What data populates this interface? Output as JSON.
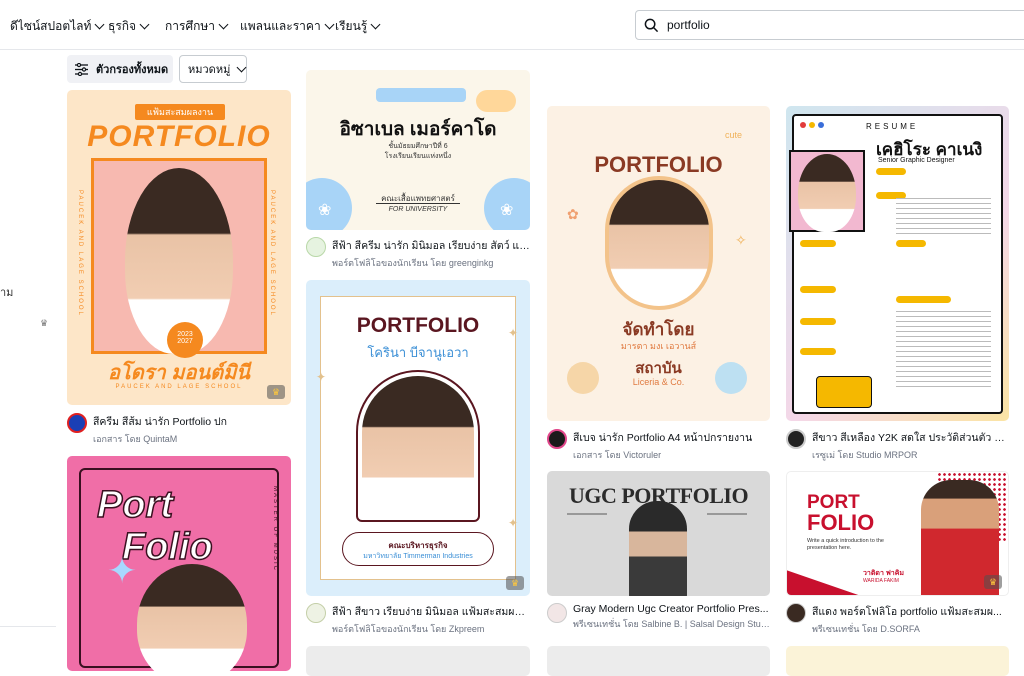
{
  "nav": {
    "items": [
      "ดีไซน์สปอตไลท์",
      "ธุรกิจ",
      "การศึกษา",
      "แพลนและราคา",
      "เรียนรู้"
    ]
  },
  "search": {
    "value": "portfolio"
  },
  "sidebar": {
    "partial_text": "าม"
  },
  "filters": {
    "all_filters": "ตัวกรองทั้งหมด",
    "category": "หมวดหมู่"
  },
  "cards": [
    {
      "title": "สีครีม สีส้ม น่ารัก Portfolio ปก",
      "subtitle": "เอกสาร โดย QuintaM",
      "preview": {
        "banner": "แฟ้มสะสมผลงาน",
        "heading": "PORTFOLIO",
        "name": "อโดรา มอนต์มินี",
        "years": [
          "2023",
          "2027"
        ],
        "footer": "PAUCEK AND LAGE SCHOOL",
        "side": "PAUCEK AND LAGE SCHOOL"
      }
    },
    {
      "title": "สีฟ้า สีครีม น่ารัก มินิมอล เรียบง่าย สัตว์ แฟ้ม...",
      "subtitle": "พอร์ตโฟลิโอของนักเรียน โดย greenginkg",
      "preview": {
        "name": "อิซาเบล เมอร์คาโด",
        "line1": "ชั้นมัธยมศึกษาปีที่ 6",
        "line2": "โรงเรียนเรียนแห่งหนึ่ง",
        "faculty": "คณะเสื้อแพทยศาสตร์",
        "for": "FOR UNIVERSITY"
      }
    },
    {
      "title": "สีเบจ น่ารัก Portfolio A4 หน้าปกรายงาน",
      "subtitle": "เอกสาร โดย Victoruler",
      "preview": {
        "heading": "PORTFOLIO",
        "by_label": "จัดทำโดย",
        "by_name": "มารตา มงเ เอวานส์",
        "school_label": "สถาบัน",
        "school_name": "Liceria & Co.",
        "tag": "cute"
      }
    },
    {
      "title": "สีขาว สีเหลือง Y2K สดใส ประวัติส่วนตัว สมัค...",
      "subtitle": "เรซูเม่ โดย Studio MRPOR",
      "preview": {
        "resume": "RESUME",
        "name": "เคฮิโระ คาเนงิ",
        "role": "Senior Graphic Designer"
      }
    },
    {
      "title": "สีฟ้า สีขาว เรียบง่าย มินิมอล แฟ้มสะสมผลง...",
      "subtitle": "พอร์ตโฟลิโอของนักเรียน โดย Zkpreem",
      "preview": {
        "heading": "PORTFOLIO",
        "name": "โครินา บีจานูเอวา",
        "faculty": "คณะบริหารธุรกิจ",
        "uni": "มหาวิทยาลัย Timmerman Industries"
      }
    },
    {
      "title": "",
      "subtitle": "",
      "preview": {
        "heading1": "Port",
        "heading2": "Folio",
        "side": "MASTER OF MUSIC"
      }
    },
    {
      "title": "Gray Modern Ugc Creator Portfolio Pres...",
      "subtitle": "พรีเซนเทชั่น โดย Salbine B. | Salsal Design Studio",
      "preview": {
        "heading": "UGC PORTFOLIO"
      }
    },
    {
      "title": "สีแดง พอร์ตโฟลิโอ portfolio แฟ้มสะสมผ...",
      "subtitle": "พรีเซนเทชั่น โดย D.SORFA",
      "preview": {
        "heading1": "PORT",
        "heading2": "FOLIO",
        "intro": "Write a quick introduction to the presentation here.",
        "name": "วาติดา ฟาคิม",
        "name_en": "WARIDA FAKIM"
      }
    }
  ],
  "colors": {
    "accent": "#8b3dff",
    "orange": "#f5891f",
    "crown": "#ffc83d"
  }
}
